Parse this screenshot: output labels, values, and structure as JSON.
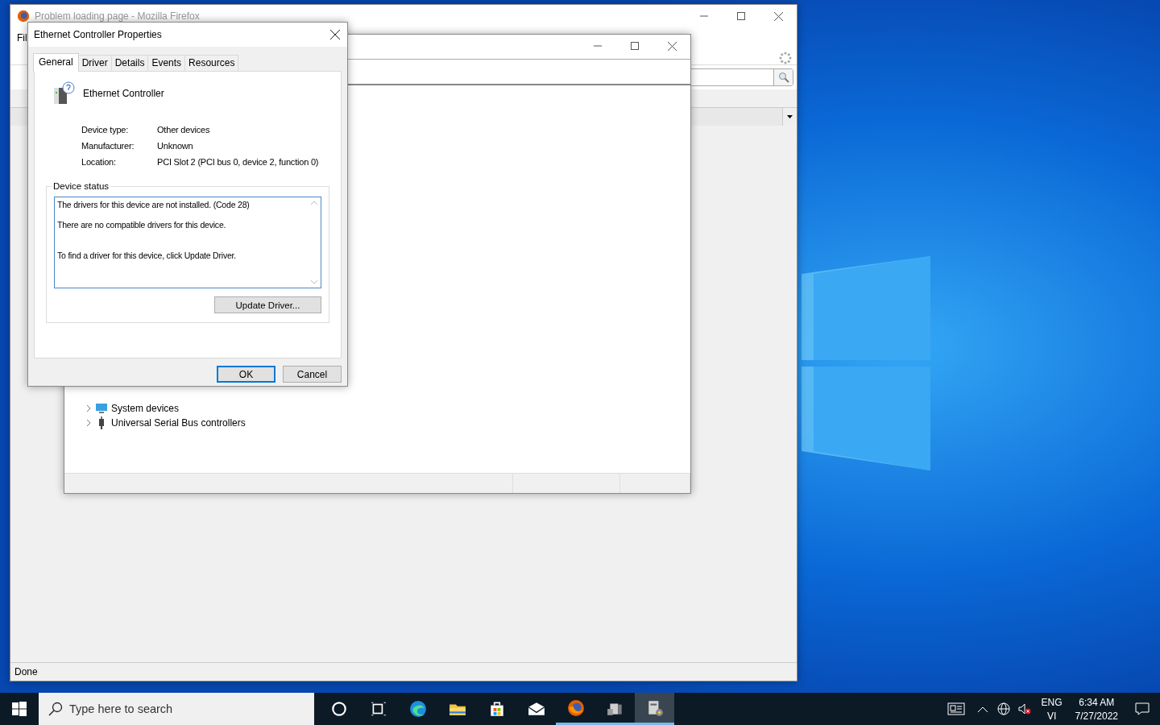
{
  "firefox_window": {
    "title": "Problem loading page - Mozilla Firefox",
    "menu": [
      "Fil"
    ],
    "status": "Done"
  },
  "device_manager_window": {
    "tree": [
      {
        "label": "System devices",
        "kind": "system",
        "expanded": false
      },
      {
        "label": "Universal Serial Bus controllers",
        "kind": "usb",
        "expanded": false
      }
    ]
  },
  "dialog": {
    "title": "Ethernet Controller Properties",
    "tabs": [
      {
        "label": "General",
        "selected": true
      },
      {
        "label": "Driver",
        "selected": false
      },
      {
        "label": "Details",
        "selected": false
      },
      {
        "label": "Events",
        "selected": false
      },
      {
        "label": "Resources",
        "selected": false
      }
    ],
    "device_name": "Ethernet Controller",
    "properties": [
      {
        "label": "Device type:",
        "value": "Other devices"
      },
      {
        "label": "Manufacturer:",
        "value": "Unknown"
      },
      {
        "label": "Location:",
        "value": "PCI Slot 2 (PCI bus 0, device 2, function 0)"
      }
    ],
    "status_group": "Device status",
    "status_lines": [
      "The drivers for this device are not installed. (Code 28)",
      "There are no compatible drivers for this device.",
      "To find a driver for this device, click Update Driver."
    ],
    "update_button": "Update Driver...",
    "buttons": [
      {
        "label": "OK",
        "kind": "default"
      },
      {
        "label": "Cancel",
        "kind": "normal"
      }
    ]
  },
  "taskbar": {
    "search": {
      "placeholder": "Type here to search"
    },
    "apps": [
      {
        "kind": "cortana",
        "running": false,
        "active": false
      },
      {
        "kind": "taskview",
        "running": false,
        "active": false
      },
      {
        "kind": "edge",
        "running": false,
        "active": false
      },
      {
        "kind": "folder",
        "running": false,
        "active": false
      },
      {
        "kind": "store",
        "running": false,
        "active": false
      },
      {
        "kind": "mail",
        "running": false,
        "active": false
      },
      {
        "kind": "firefox",
        "running": true,
        "active": false
      },
      {
        "kind": "devices",
        "running": true,
        "active": false
      },
      {
        "kind": "devmgr",
        "running": true,
        "active": true
      }
    ],
    "language": [
      "ENG",
      "VI"
    ],
    "time": "6:34 AM",
    "date": "7/27/2022"
  }
}
